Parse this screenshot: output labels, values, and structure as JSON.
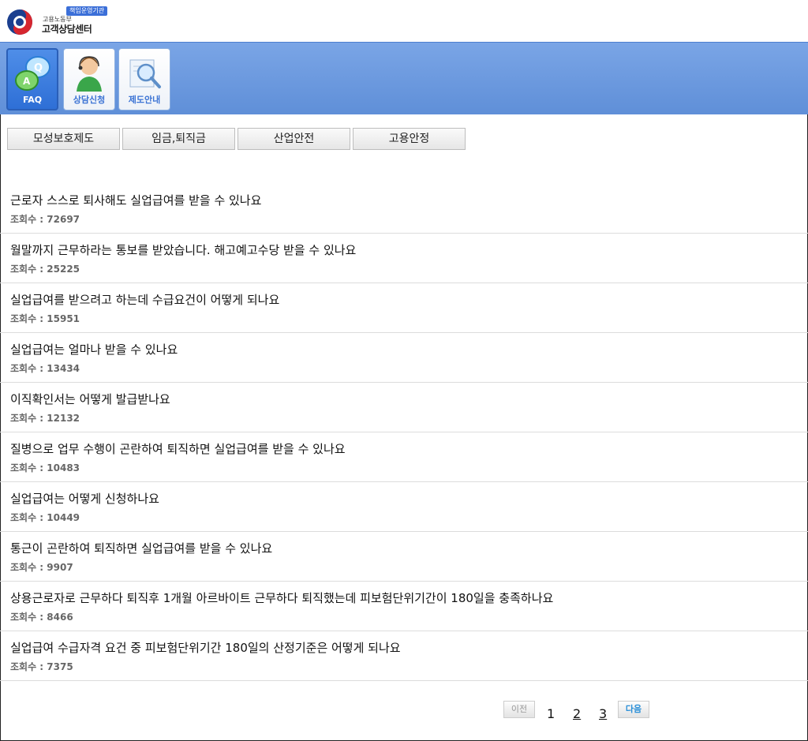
{
  "header": {
    "badge": "책임운영기관",
    "subtitle": "고용노동부",
    "title": "고객상담센터"
  },
  "toolbar": {
    "buttons": [
      {
        "label": "FAQ",
        "icon": "qa-bubbles-icon",
        "active": true
      },
      {
        "label": "상담신청",
        "icon": "counselor-icon",
        "active": false
      },
      {
        "label": "제도안내",
        "icon": "magnifier-icon",
        "active": false
      }
    ]
  },
  "categories": [
    "모성보호제도",
    "임금,퇴직금",
    "산업안전",
    "고용안정"
  ],
  "faq": {
    "views_label": "조회수 : ",
    "items": [
      {
        "question": "근로자 스스로 퇴사해도 실업급여를 받을 수 있나요",
        "views": "72697"
      },
      {
        "question": "월말까지 근무하라는 통보를 받았습니다. 해고예고수당 받을 수 있나요",
        "views": "25225"
      },
      {
        "question": "실업급여를 받으려고 하는데 수급요건이 어떻게 되나요",
        "views": "15951"
      },
      {
        "question": "실업급여는 얼마나 받을 수 있나요",
        "views": "13434"
      },
      {
        "question": "이직확인서는 어떻게 발급받나요",
        "views": "12132"
      },
      {
        "question": "질병으로 업무 수행이 곤란하여 퇴직하면 실업급여를 받을 수 있나요",
        "views": "10483"
      },
      {
        "question": "실업급여는 어떻게 신청하나요",
        "views": "10449"
      },
      {
        "question": "통근이 곤란하여 퇴직하면 실업급여를 받을 수 있나요",
        "views": "9907"
      },
      {
        "question": "상용근로자로 근무하다 퇴직후 1개월 아르바이트 근무하다 퇴직했는데 피보험단위기간이 180일을 충족하나요",
        "views": "8466"
      },
      {
        "question": "실업급여 수급자격 요건 중 피보험단위기간 180일의 산정기준은 어떻게 되나요",
        "views": "7375"
      }
    ]
  },
  "pagination": {
    "prev": "이전",
    "next": "다음",
    "pages": [
      "1",
      "2",
      "3"
    ],
    "current": "1"
  },
  "colors": {
    "toolbar": "#6b98de",
    "accent": "#3b73d4",
    "next": "#2a8fd8"
  }
}
